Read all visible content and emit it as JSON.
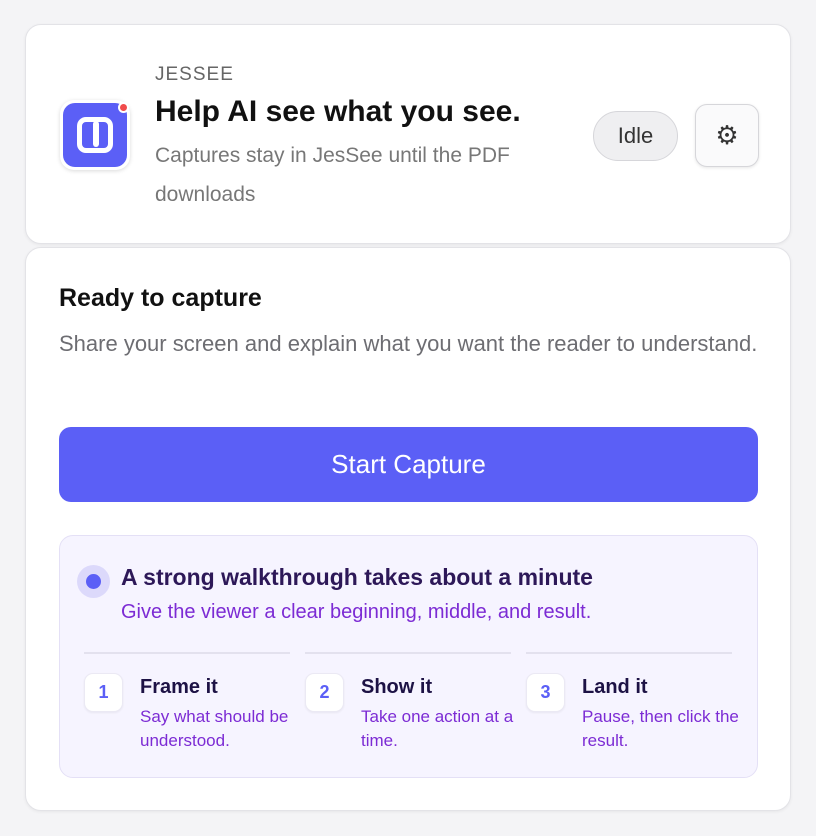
{
  "header": {
    "brand": "JESSEE",
    "headline": "Help AI see what you see.",
    "tagline": "Captures stay in JesSee until the PDF downloads",
    "status": "Idle",
    "settings_icon": "⚙",
    "accent_color": "#5b5ff6",
    "notification_dot_color": "#f04b4b"
  },
  "main": {
    "title": "Ready to capture",
    "description": "Share your screen and explain what you want the reader to understand.",
    "start_button": "Start Capture",
    "tip": {
      "title": "A strong walkthrough takes about a minute",
      "subtitle": "Give the viewer a clear beginning, middle, and result.",
      "steps": [
        {
          "number": "1",
          "title": "Frame it",
          "description": "Say what should be understood."
        },
        {
          "number": "2",
          "title": "Show it",
          "description": "Take one action at a time."
        },
        {
          "number": "3",
          "title": "Land it",
          "description": "Pause, then click the result."
        }
      ]
    }
  }
}
